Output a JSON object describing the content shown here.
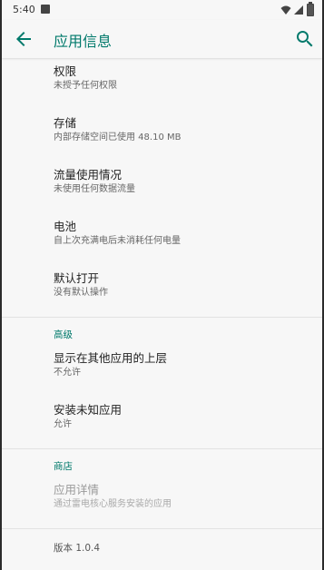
{
  "status_bar": {
    "time": "5:40",
    "icons": [
      "notification-icon",
      "wifi-icon",
      "signal-icon",
      "battery-icon"
    ]
  },
  "app_bar": {
    "title": "应用信息",
    "back_icon": "arrow-back-icon",
    "search_icon": "search-icon",
    "accent_color": "#00796b"
  },
  "items_main": [
    {
      "title": "权限",
      "subtitle": "未授予任何权限"
    },
    {
      "title": "存储",
      "subtitle": "内部存储空间已使用 48.10 MB"
    },
    {
      "title": "流量使用情况",
      "subtitle": "未使用任何数据流量"
    },
    {
      "title": "电池",
      "subtitle": "自上次充满电后未消耗任何电量"
    },
    {
      "title": "默认打开",
      "subtitle": "没有默认操作"
    }
  ],
  "section_advanced": {
    "header": "高级",
    "items": [
      {
        "title": "显示在其他应用的上层",
        "subtitle": "不允许"
      },
      {
        "title": "安装未知应用",
        "subtitle": "允许"
      }
    ]
  },
  "section_store": {
    "header": "商店",
    "items": [
      {
        "title": "应用详情",
        "subtitle": "通过雷电核心服务安装的应用"
      }
    ]
  },
  "version": "版本 1.0.4"
}
